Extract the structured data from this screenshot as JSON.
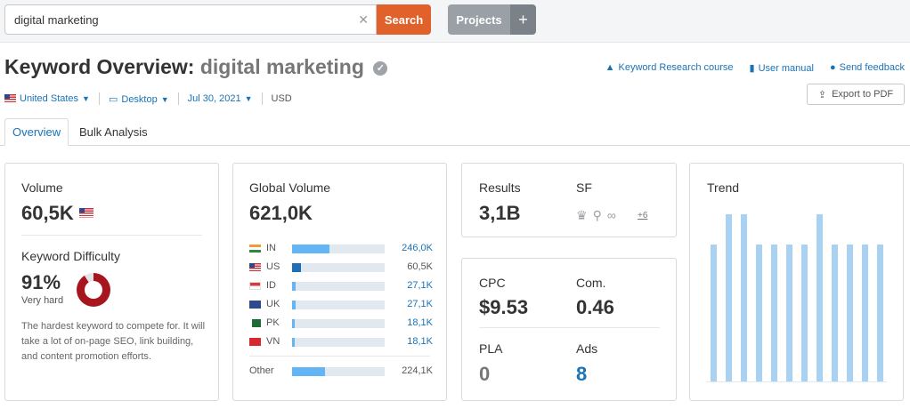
{
  "search": {
    "value": "digital marketing",
    "clear_icon": "close-icon",
    "button_label": "Search"
  },
  "projects": {
    "label": "Projects",
    "add_label": "+"
  },
  "header": {
    "title_prefix": "Keyword Overview:",
    "title_keyword": "digital marketing",
    "links": [
      {
        "icon": "graduation-cap-icon",
        "label": "Keyword Research course"
      },
      {
        "icon": "book-icon",
        "label": "User manual"
      },
      {
        "icon": "chat-bubble-icon",
        "label": "Send feedback"
      }
    ],
    "export_label": "Export to PDF"
  },
  "filters": {
    "country": "United States",
    "device": "Desktop",
    "date": "Jul 30, 2021",
    "currency": "USD"
  },
  "tabs": [
    {
      "label": "Overview",
      "active": true
    },
    {
      "label": "Bulk Analysis",
      "active": false
    }
  ],
  "volume": {
    "label": "Volume",
    "value": "60,5K"
  },
  "keyword_difficulty": {
    "label": "Keyword Difficulty",
    "value": "91%",
    "level": "Very hard",
    "percent": 91,
    "color": "#a7151e",
    "description": "The hardest keyword to compete for. It will take a lot of on-page SEO, link building, and content promotion efforts."
  },
  "global_volume": {
    "label": "Global Volume",
    "value": "621,0K",
    "countries": [
      {
        "code": "IN",
        "value": "246,0K",
        "share": 0.4
      },
      {
        "code": "US",
        "value": "60,5K",
        "share": 0.1
      },
      {
        "code": "ID",
        "value": "27,1K",
        "share": 0.04
      },
      {
        "code": "UK",
        "value": "27,1K",
        "share": 0.04
      },
      {
        "code": "PK",
        "value": "18,1K",
        "share": 0.03
      },
      {
        "code": "VN",
        "value": "18,1K",
        "share": 0.03
      }
    ],
    "other": {
      "label": "Other",
      "value": "224,1K",
      "share": 0.36
    }
  },
  "results": {
    "label": "Results",
    "value": "3,1B"
  },
  "serp_features": {
    "label": "SF",
    "icons": [
      "crown-icon",
      "location-pin-icon",
      "link-icon"
    ],
    "more": "+6"
  },
  "cpc": {
    "label": "CPC",
    "value": "$9.53"
  },
  "competition": {
    "label": "Com.",
    "value": "0.46"
  },
  "pla": {
    "label": "PLA",
    "value": "0"
  },
  "ads": {
    "label": "Ads",
    "value": "8"
  },
  "trend": {
    "label": "Trend",
    "values": [
      0.82,
      1.0,
      1.0,
      0.82,
      0.82,
      0.82,
      0.82,
      1.0,
      0.82,
      0.82,
      0.82,
      0.82
    ]
  },
  "colors": {
    "accent": "#e0612a",
    "link": "#1a73b7",
    "bar": "#64b5f6",
    "trend": "#a9d1f2"
  }
}
